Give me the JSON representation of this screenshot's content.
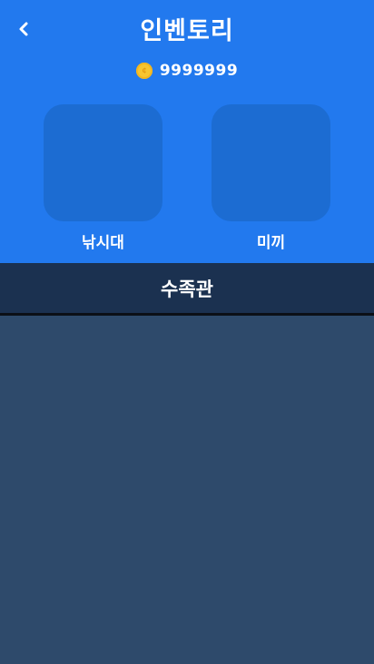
{
  "header": {
    "title": "인벤토리",
    "back_icon": "chevron-left-icon",
    "background_color": "#2279EE"
  },
  "currency": {
    "icon": "coin-icon",
    "value": "9999999",
    "coin_color": "#F7C531"
  },
  "slots": [
    {
      "label": "낚시대",
      "box_color": "#1C6CD2"
    },
    {
      "label": "미끼",
      "box_color": "#1C6CD2"
    }
  ],
  "aquarium": {
    "label": "수족관",
    "background_color": "#1B3150"
  },
  "content": {
    "background_color": "#2E4A6B"
  }
}
